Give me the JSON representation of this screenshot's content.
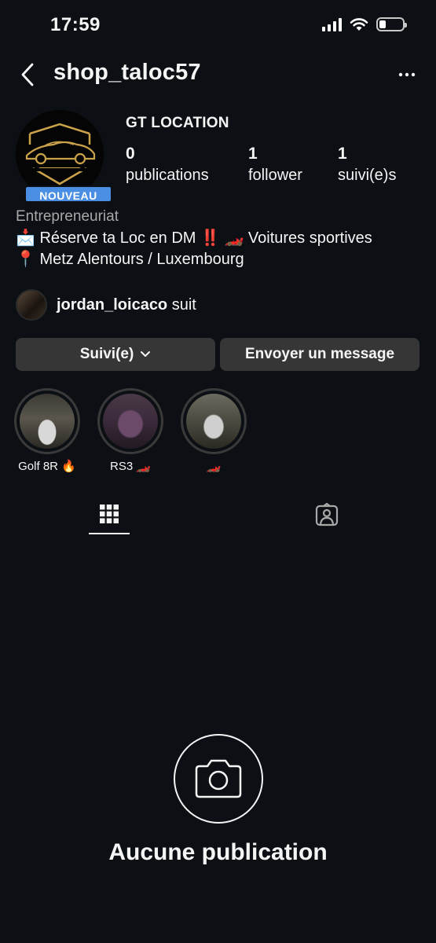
{
  "status": {
    "time": "17:59",
    "battery_level": 0.3
  },
  "header": {
    "username": "shop_taloc57"
  },
  "profile": {
    "display_name": "GT LOCATION",
    "badge": "NOUVEAU",
    "stats": [
      {
        "value": "0",
        "label": "publications"
      },
      {
        "value": "1",
        "label": "follower"
      },
      {
        "value": "1",
        "label": "suivi(e)s"
      }
    ],
    "category": "Entrepreneuriat",
    "bio_line_1": "📩 Réserve ta Loc en DM ‼️ 🏎️ Voitures sportives",
    "bio_line_2": "📍 Metz Alentours / Luxembourg"
  },
  "followed_by": {
    "username": "jordan_loicaco",
    "suffix": " suit"
  },
  "buttons": {
    "follow": "Suivi(e)",
    "message": "Envoyer un message"
  },
  "highlights": [
    {
      "label": "Golf 8R 🔥"
    },
    {
      "label": "RS3 🏎️"
    },
    {
      "label": "🏎️"
    }
  ],
  "empty_state": {
    "title": "Aucune publication"
  },
  "colors": {
    "background": "#0c1014",
    "button": "#363636",
    "badge": "#4a8fe3",
    "logo_gold": "#c9a24a"
  }
}
